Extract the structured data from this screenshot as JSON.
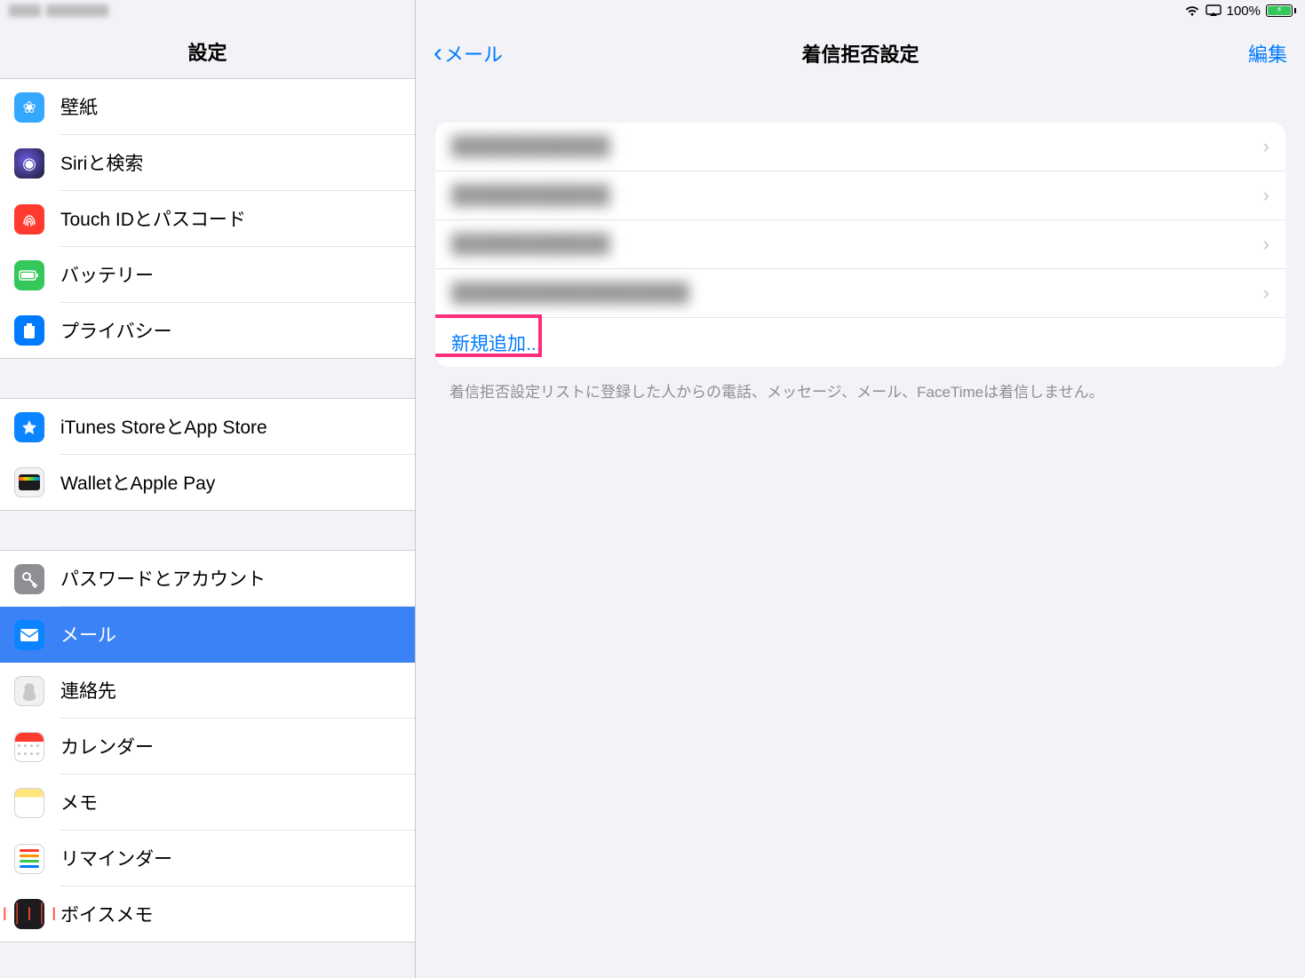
{
  "status": {
    "battery_pct": "100%"
  },
  "sidebar": {
    "title": "設定",
    "groups": [
      {
        "items": [
          {
            "id": "wallpaper",
            "label": "壁紙"
          },
          {
            "id": "siri",
            "label": "Siriと検索"
          },
          {
            "id": "touchid",
            "label": "Touch IDとパスコード"
          },
          {
            "id": "battery",
            "label": "バッテリー"
          },
          {
            "id": "privacy",
            "label": "プライバシー"
          }
        ]
      },
      {
        "items": [
          {
            "id": "appstore",
            "label": "iTunes StoreとApp Store"
          },
          {
            "id": "wallet",
            "label": "WalletとApple Pay"
          }
        ]
      },
      {
        "items": [
          {
            "id": "passwords",
            "label": "パスワードとアカウント"
          },
          {
            "id": "mail",
            "label": "メール",
            "selected": true
          },
          {
            "id": "contacts",
            "label": "連絡先"
          },
          {
            "id": "calendar",
            "label": "カレンダー"
          },
          {
            "id": "notes",
            "label": "メモ"
          },
          {
            "id": "reminders",
            "label": "リマインダー"
          },
          {
            "id": "voicememos",
            "label": "ボイスメモ"
          }
        ]
      }
    ]
  },
  "detail": {
    "back_label": "メール",
    "title": "着信拒否設定",
    "edit_label": "編集",
    "blocked": [
      {
        "label": "████████████"
      },
      {
        "label": "████████████"
      },
      {
        "label": "████████████"
      },
      {
        "label": "██████████████████"
      }
    ],
    "add_new_label": "新規追加...",
    "footer": "着信拒否設定リストに登録した人からの電話、メッセージ、メール、FaceTimeは着信しません。"
  }
}
